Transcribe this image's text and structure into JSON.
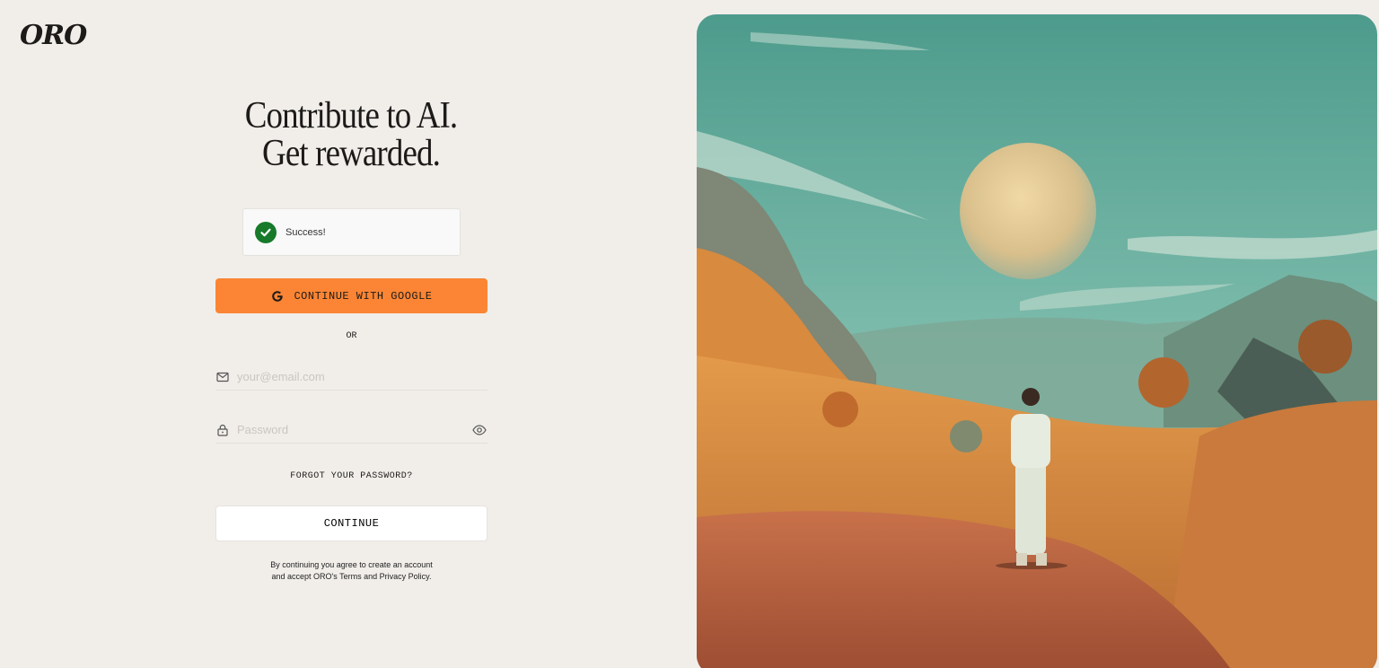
{
  "brand": {
    "logo_text": "ORO"
  },
  "headline": {
    "line1": "Contribute to AI.",
    "line2": "Get rewarded."
  },
  "toast": {
    "text": "Success!",
    "icon": "check-circle-icon",
    "color": "#167a2a"
  },
  "google_button": {
    "label": "CONTINUE WITH GOOGLE",
    "icon": "google-icon",
    "color": "#fb8534"
  },
  "divider": {
    "text": "OR"
  },
  "email": {
    "placeholder": "your@email.com",
    "value": "",
    "icon": "mail-icon"
  },
  "password": {
    "placeholder": "Password",
    "value": "",
    "icon": "lock-icon",
    "toggle_icon": "eye-icon"
  },
  "forgot": {
    "label": "FORGOT YOUR PASSWORD?"
  },
  "continue_button": {
    "label": "CONTINUE"
  },
  "terms": {
    "line1": "By continuing you agree to create an account",
    "line2": "and accept ORO's Terms and Privacy Policy."
  },
  "hero_image": {
    "description_icon": "landscape-illustration"
  }
}
